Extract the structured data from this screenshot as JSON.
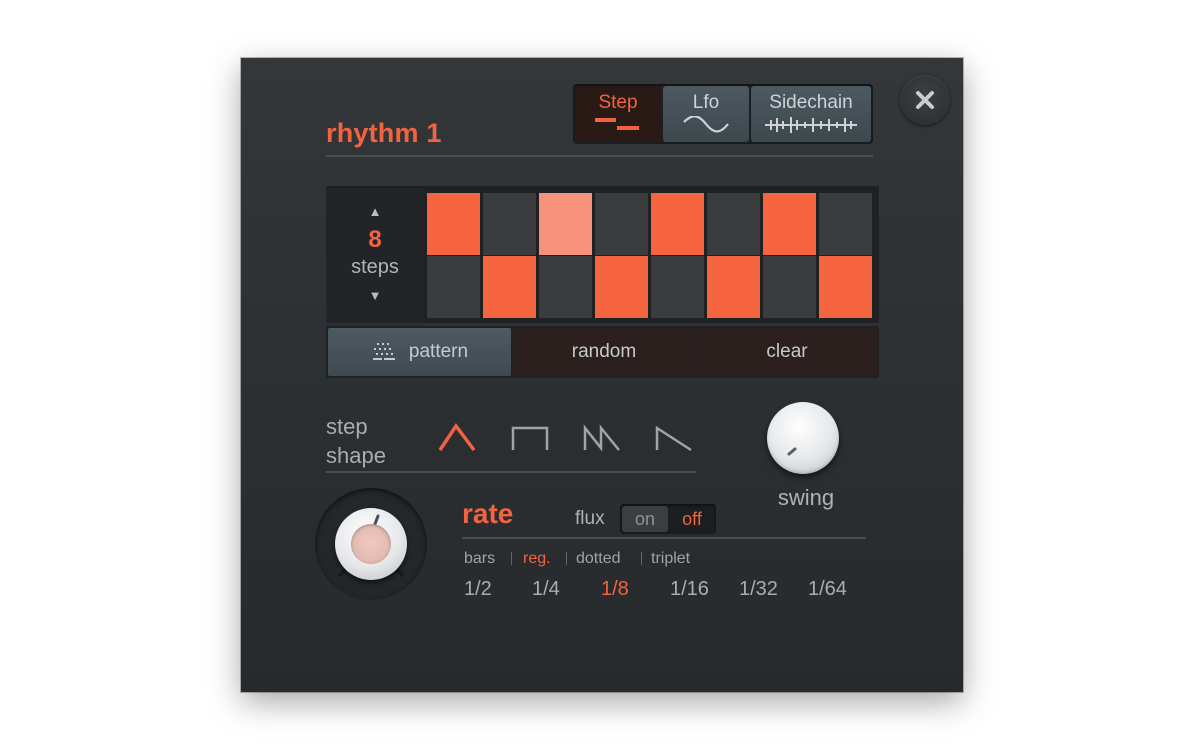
{
  "colors": {
    "accent": "#f26340",
    "panel_bg": "#2e3134",
    "active_step": "#f5633f",
    "mid_step": "#f6917b",
    "off_step": "#3a3c3e"
  },
  "header": {
    "title": "rhythm 1",
    "tabs": [
      {
        "label": "Step",
        "icon": "step-icon",
        "active": true
      },
      {
        "label": "Lfo",
        "icon": "sine-wave-icon",
        "active": false
      },
      {
        "label": "Sidechain",
        "icon": "waveform-icon",
        "active": false
      }
    ],
    "close_icon": "close-icon"
  },
  "sequencer": {
    "steps_value": "8",
    "steps_label": "steps",
    "top_row": [
      "on",
      "off",
      "mid",
      "off",
      "on",
      "off",
      "on",
      "off"
    ],
    "bottom_row": [
      "off",
      "on",
      "off",
      "on",
      "off",
      "on",
      "off",
      "on"
    ]
  },
  "actions": {
    "pattern_label": "pattern",
    "random_label": "random",
    "clear_label": "clear"
  },
  "step_shape": {
    "label_line1": "step",
    "label_line2": "shape",
    "shapes": [
      "triangle-shape-icon",
      "square-shape-icon",
      "saw-up-shape-icon",
      "saw-down-shape-icon"
    ],
    "selected_index": 0
  },
  "swing": {
    "label": "swing"
  },
  "rate": {
    "title": "rate",
    "flux_label": "flux",
    "flux_on": "on",
    "flux_off": "off",
    "flux_selected": "off",
    "modes": [
      "bars",
      "reg.",
      "dotted",
      "triplet"
    ],
    "mode_selected": "reg.",
    "divisions": [
      "1/2",
      "1/4",
      "1/8",
      "1/16",
      "1/32",
      "1/64"
    ],
    "division_selected": "1/8"
  }
}
